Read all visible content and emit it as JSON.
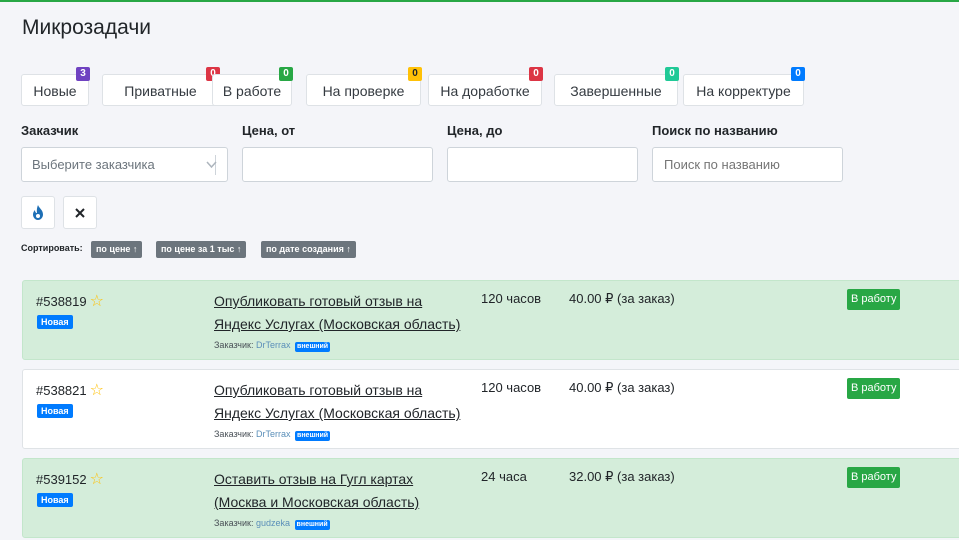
{
  "page": {
    "title": "Микрозадачи"
  },
  "colors": {
    "top_line": "#28a745",
    "card_green": "#d4edda",
    "status_blue": "#007bff",
    "take_green": "#28a745"
  },
  "tabs": [
    {
      "label": "Новые",
      "count": "3",
      "badge_color": "#6f42c1"
    },
    {
      "label": "Приватные",
      "count": "0",
      "badge_color": "#dc3545"
    },
    {
      "label": "В работе",
      "count": "0",
      "badge_color": "#28a745"
    },
    {
      "label": "На проверке",
      "count": "0",
      "badge_color": "#ffc107"
    },
    {
      "label": "На доработке",
      "count": "0",
      "badge_color": "#dc3545"
    },
    {
      "label": "Завершенные",
      "count": "0",
      "badge_color": "#20c997"
    },
    {
      "label": "На корректуре",
      "count": "0",
      "badge_color": "#007bff"
    }
  ],
  "filters": {
    "customer_label": "Заказчик",
    "customer_placeholder": "Выберите заказчика",
    "price_from_label": "Цена, от",
    "price_to_label": "Цена, до",
    "search_label": "Поиск по названию",
    "search_placeholder": "Поиск по названию",
    "apply_icon": "fire-icon",
    "reset_icon": "close-icon"
  },
  "sort": {
    "label": "Сортировать:",
    "options": [
      "по цене ↑",
      "по цене за 1 тыс ↑",
      "по дате создания ↑"
    ]
  },
  "tasks": [
    {
      "id": "#538819",
      "status": "Новая",
      "title_line1": "Опубликовать готовый отзыв на",
      "title_line2": "Яндекс Услугах (Московская область)",
      "client_label": "Заказчик:",
      "client": "DrTerrax",
      "client_tag": "внешний",
      "time": "120 часов",
      "price": "40.00 ₽ (за заказ)",
      "action": "В работу",
      "highlight": true
    },
    {
      "id": "#538821",
      "status": "Новая",
      "title_line1": "Опубликовать готовый отзыв на",
      "title_line2": "Яндекс Услугах (Московская область)",
      "client_label": "Заказчик:",
      "client": "DrTerrax",
      "client_tag": "внешний",
      "time": "120 часов",
      "price": "40.00 ₽ (за заказ)",
      "action": "В работу",
      "highlight": false
    },
    {
      "id": "#539152",
      "status": "Новая",
      "title_line1": "Оставить отзыв на Гугл картах",
      "title_line2": "(Москва и Московская область)",
      "client_label": "Заказчик:",
      "client": "gudzeka",
      "client_tag": "внешний",
      "time": "24 часа",
      "price": "32.00 ₽ (за заказ)",
      "action": "В работу",
      "highlight": true
    }
  ]
}
